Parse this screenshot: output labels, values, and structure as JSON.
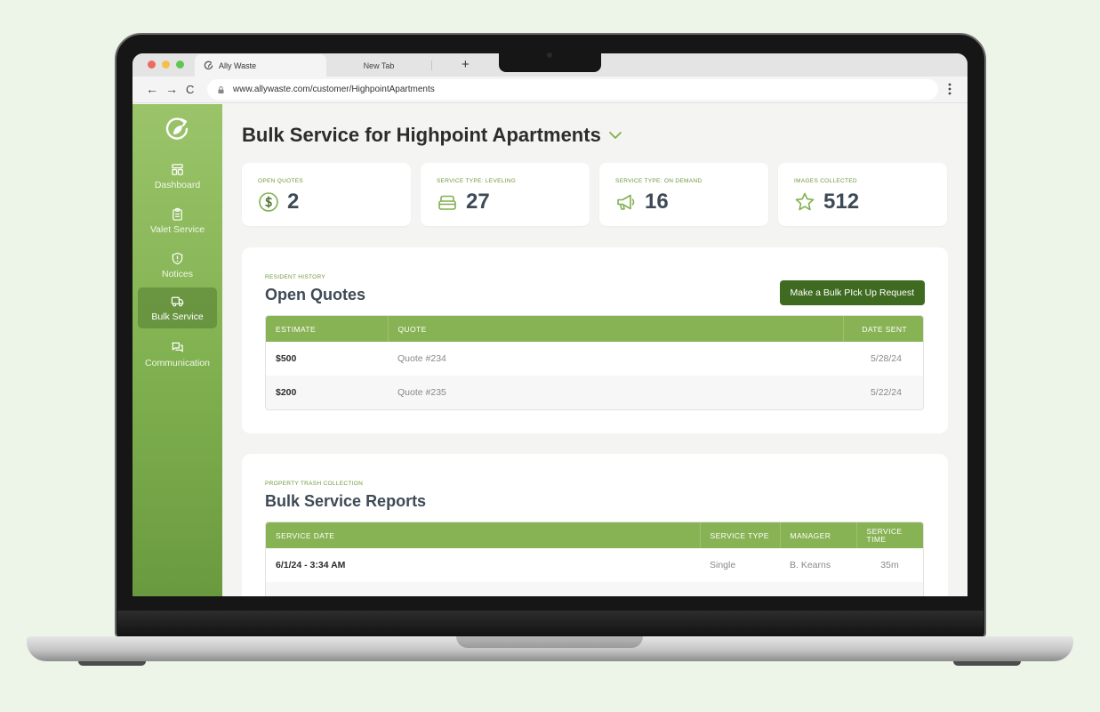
{
  "browser": {
    "active_tab_title": "Ally Waste",
    "inactive_tab_title": "New Tab",
    "new_tab_symbol": "+",
    "url": "www.allywaste.com/customer/HighpointApartments",
    "back": "←",
    "forward": "→",
    "reload": "C"
  },
  "sidebar": {
    "items": [
      {
        "label": "Dashboard",
        "icon": "dashboard-icon"
      },
      {
        "label": "Valet Service",
        "icon": "clipboard-icon"
      },
      {
        "label": "Notices",
        "icon": "shield-alert-icon"
      },
      {
        "label": "Bulk Service",
        "icon": "truck-icon",
        "active": true
      },
      {
        "label": "Communication",
        "icon": "chat-bubbles-icon"
      }
    ]
  },
  "page": {
    "title": "Bulk Service for Highpoint Apartments"
  },
  "stats": [
    {
      "label": "OPEN QUOTES",
      "value": "2",
      "icon": "dollar-circle-icon"
    },
    {
      "label": "SERVICE TYPE: LEVELING",
      "value": "27",
      "icon": "stack-icon"
    },
    {
      "label": "SERVICE TYPE: ON DEMAND",
      "value": "16",
      "icon": "megaphone-icon"
    },
    {
      "label": "IMAGES COLLECTED",
      "value": "512",
      "icon": "star-icon"
    }
  ],
  "open_quotes": {
    "eyebrow": "RESIDENT HISTORY",
    "title": "Open Quotes",
    "button_label": "Make a Bulk PIck Up Request",
    "columns": [
      "ESTIMATE",
      "QUOTE",
      "DATE SENT"
    ],
    "rows": [
      {
        "estimate": "$500",
        "quote": "Quote #234",
        "date_sent": "5/28/24"
      },
      {
        "estimate": "$200",
        "quote": "Quote #235",
        "date_sent": "5/22/24"
      }
    ]
  },
  "reports": {
    "eyebrow": "PROPERTY TRASH COLLECTION",
    "title": "Bulk Service Reports",
    "columns": [
      "SERVICE DATE",
      "SERVICE TYPE",
      "MANAGER",
      "SERVICE TIME"
    ],
    "rows": [
      {
        "service_date": "6/1/24 - 3:34 AM",
        "service_type": "Single",
        "manager": "B. Kearns",
        "service_time": "35m"
      }
    ]
  },
  "colors": {
    "brand_green": "#7fb04f",
    "header_green": "#88b355",
    "button_dark_green": "#3f6b21",
    "accent_label": "#6e9a3c"
  }
}
